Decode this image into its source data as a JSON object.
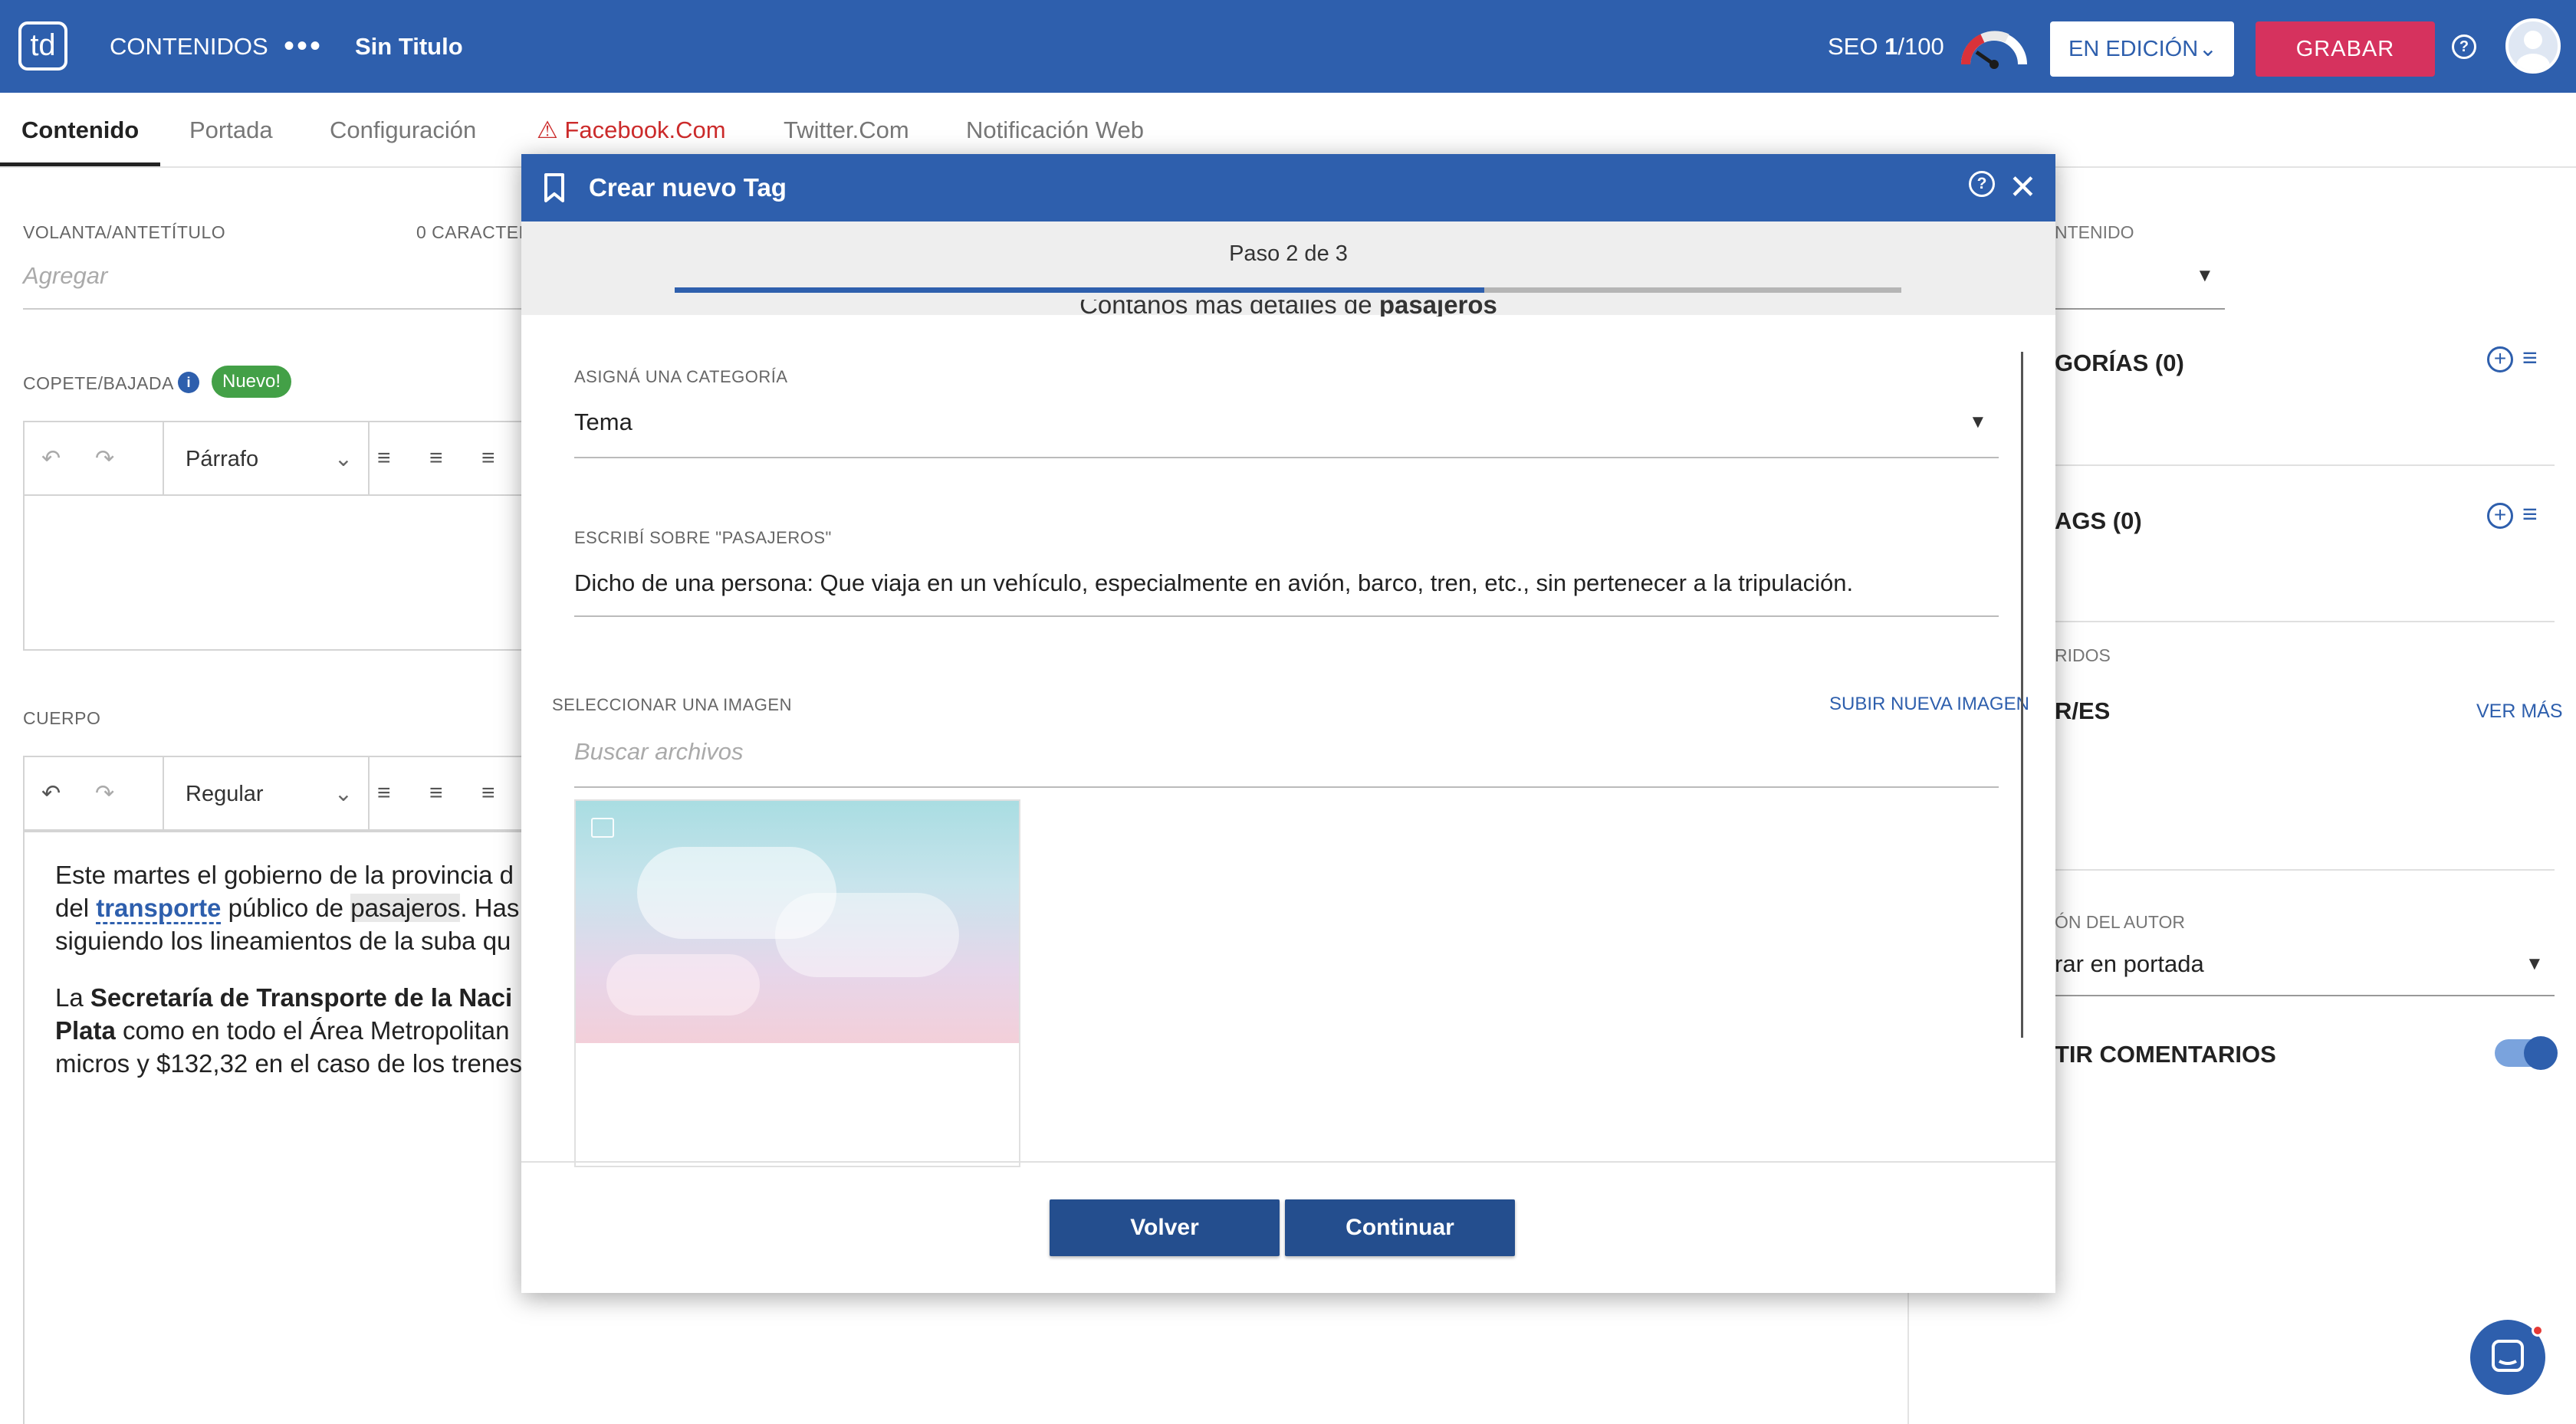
{
  "header": {
    "logo": "td",
    "section_label": "CONTENIDOS",
    "more_label": "•••",
    "doc_title": "Sin Titulo",
    "seo_prefix": "SEO ",
    "seo_score": "1",
    "seo_suffix": "/100",
    "state_label": "EN EDICIÓN",
    "save_label": "GRABAR",
    "colors": {
      "bar": "#2e5fad",
      "save": "#d6325e"
    }
  },
  "tabs": [
    {
      "label": "Contenido"
    },
    {
      "label": "Portada"
    },
    {
      "label": "Configuración"
    },
    {
      "label": "Facebook.Com"
    },
    {
      "label": "Twitter.Com"
    },
    {
      "label": "Notificación Web"
    }
  ],
  "left": {
    "volanta_label": "VOLANTA/ANTETÍTULO",
    "volanta_counter": "0 CARACTER",
    "volanta_placeholder": "Agregar",
    "copete_label": "COPETE/BAJADA",
    "new_badge": "Nuevo!",
    "copete_style": "Párrafo",
    "cuerpo_label": "CUERPO",
    "cuerpo_style": "Regular",
    "body": {
      "p1_l1": "Este martes el gobierno de la provincia d",
      "p1_l2_a": "del ",
      "p1_l2_link": "transporte",
      "p1_l2_b": " público de ",
      "p1_l2_hl": "pasajeros",
      "p1_l2_c": ". Has",
      "p1_l3": "siguiendo los lineamientos de la suba qu",
      "p2_l1_a": "La ",
      "p2_l1_b": "Secretaría de Transporte de la Naci",
      "p2_l2_a": "Plata",
      "p2_l2_b": " como en todo el Área Metropolitan",
      "p2_l3": "micros y $132,32 en el caso de los trenes"
    }
  },
  "right": {
    "content_label": "NTENIDO",
    "categories_label": "GORÍAS (0)",
    "tags_label": "AGS (0)",
    "related_label": "RIDOS",
    "authors_label": "R/ES",
    "see_more": "VER MÁS",
    "author_pos_label": "ÓN DEL AUTOR",
    "author_pos_value": "rar en portada",
    "comments_label": "TIR COMENTARIOS",
    "comments_enabled": true
  },
  "modal": {
    "title": "Crear nuevo Tag",
    "step_text": "Paso 2 de 3",
    "progress_fraction": 0.66,
    "intro_text": "Contanos más detalles de",
    "intro_term": "pasajeros",
    "category_label": "ASIGNÁ UNA CATEGORÍA",
    "category_value": "Tema",
    "description_label": "ESCRIBÍ SOBRE \"PASAJEROS\"",
    "description_value": "Dicho de una persona: Que viaja en un vehículo, especialmente en avión, barco, tren, etc., sin pertenecer a la tripulación.",
    "image_label": "SELECCIONAR UNA IMAGEN",
    "upload_label": "SUBIR NUEVA IMAGEN",
    "search_placeholder": "Buscar archivos",
    "back_label": "Volver",
    "continue_label": "Continuar"
  }
}
